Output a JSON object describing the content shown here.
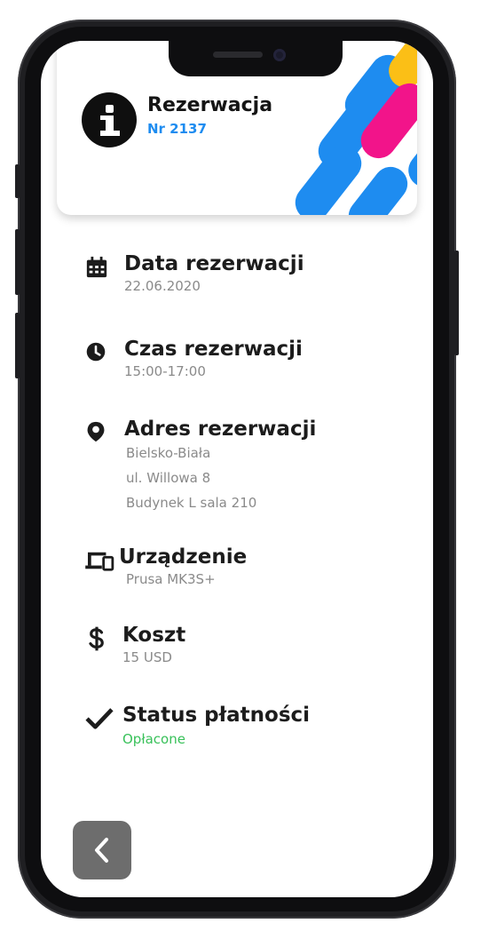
{
  "header": {
    "title": "Rezerwacja",
    "number": "Nr 2137"
  },
  "details": {
    "date": {
      "label": "Data rezerwacji",
      "value": "22.06.2020"
    },
    "time": {
      "label": "Czas rezerwacji",
      "value": "15:00-17:00"
    },
    "address": {
      "label": "Adres rezerwacji",
      "lines": [
        "Bielsko-Biała",
        "ul. Willowa 8",
        "Budynek L sala 210"
      ]
    },
    "device": {
      "label": "Urządzenie",
      "value": "Prusa MK3S+"
    },
    "cost": {
      "label": "Koszt",
      "value": "15 USD"
    },
    "payment": {
      "label": "Status płatności",
      "value": "Opłacone"
    }
  },
  "colors": {
    "accent_blue": "#1e8cf0",
    "stripe_pink": "#f2148a",
    "stripe_yellow": "#fbbf16",
    "status_green": "#39c15a"
  }
}
